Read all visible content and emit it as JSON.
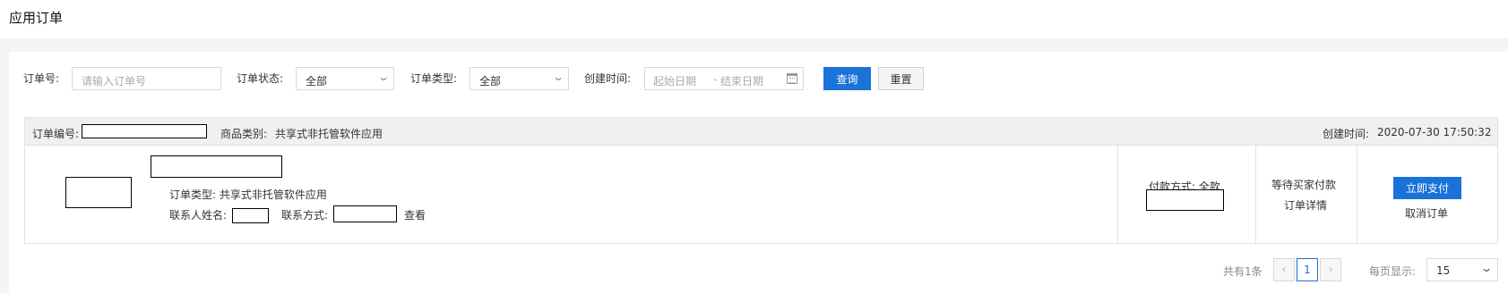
{
  "page": {
    "title": "应用订单"
  },
  "filters": {
    "order_no_label": "订单号:",
    "order_no_placeholder": "请输入订单号",
    "status_label": "订单状态:",
    "status_value": "全部",
    "type_label": "订单类型:",
    "type_value": "全部",
    "created_label": "创建时间:",
    "start_placeholder": "起始日期",
    "range_sep": "-",
    "end_placeholder": "结束日期",
    "query_label": "查询",
    "reset_label": "重置"
  },
  "order": {
    "number_label": "订单编号:",
    "category_label": "商品类别:",
    "category_value": "共享式非托管软件应用",
    "created_label": "创建时间:",
    "created_value": "2020-07-30 17:50:32",
    "type_line": "订单类型: 共享式非托管软件应用",
    "contact_name_label": "联系人姓名:",
    "contact_method_label": "联系方式:",
    "view_label": "查看",
    "payment_text": "付款方式: 全款",
    "status_text": "等待买家付款",
    "detail_link": "订单详情",
    "pay_button": "立即支付",
    "cancel_link": "取消订单"
  },
  "pagination": {
    "total_text": "共有1条",
    "prev_icon": "chevron-left-icon",
    "current_page": "1",
    "next_icon": "chevron-right-icon",
    "page_size_label": "每页显示:",
    "page_size_value": "15"
  },
  "colors": {
    "primary": "#1a73d9",
    "header_bg": "#f0f0f0",
    "page_bg": "#f4f5f7"
  }
}
